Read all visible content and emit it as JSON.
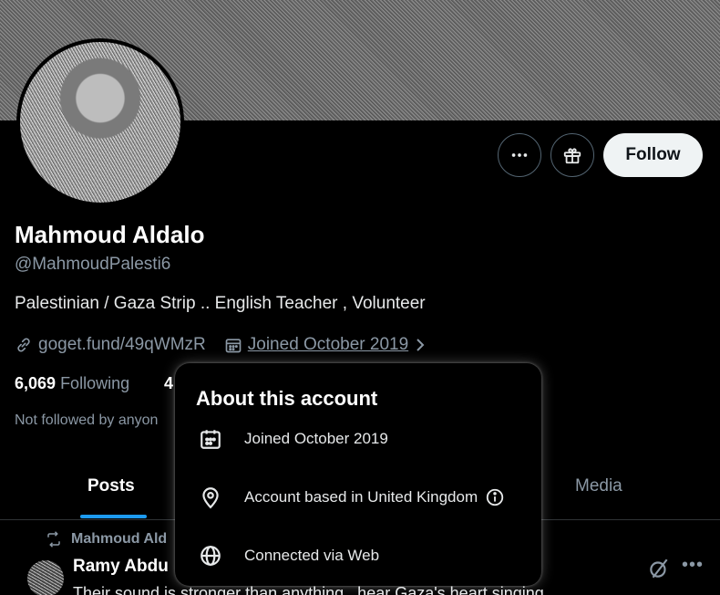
{
  "profile": {
    "name": "Mahmoud Aldalo",
    "handle": "@MahmoudPalesti6",
    "bio": "Palestinian / Gaza Strip .. English Teacher , Volunteer",
    "link": "goget.fund/49qWMzR",
    "joined": "Joined October 2019",
    "following_count": "6,069",
    "following_label": "Following",
    "followers_count_partial": "4",
    "not_followed": "Not followed by anyon"
  },
  "actions": {
    "more_icon": "more-horizontal-icon",
    "gift_icon": "gift-icon",
    "follow_label": "Follow"
  },
  "tabs": {
    "posts": "Posts",
    "media": "Media"
  },
  "feed": {
    "repost_by": "Mahmoud Ald",
    "author": "Ramy Abdu",
    "text": "Their sound is stronger than anything...hear Gaza's heart singing"
  },
  "about": {
    "title": "About this account",
    "joined": "Joined October 2019",
    "location": "Account based in United Kingdom",
    "connection": "Connected via Web"
  },
  "colors": {
    "accent": "#1d9bf0",
    "background": "#000000",
    "secondary_text": "#8b98a5"
  }
}
